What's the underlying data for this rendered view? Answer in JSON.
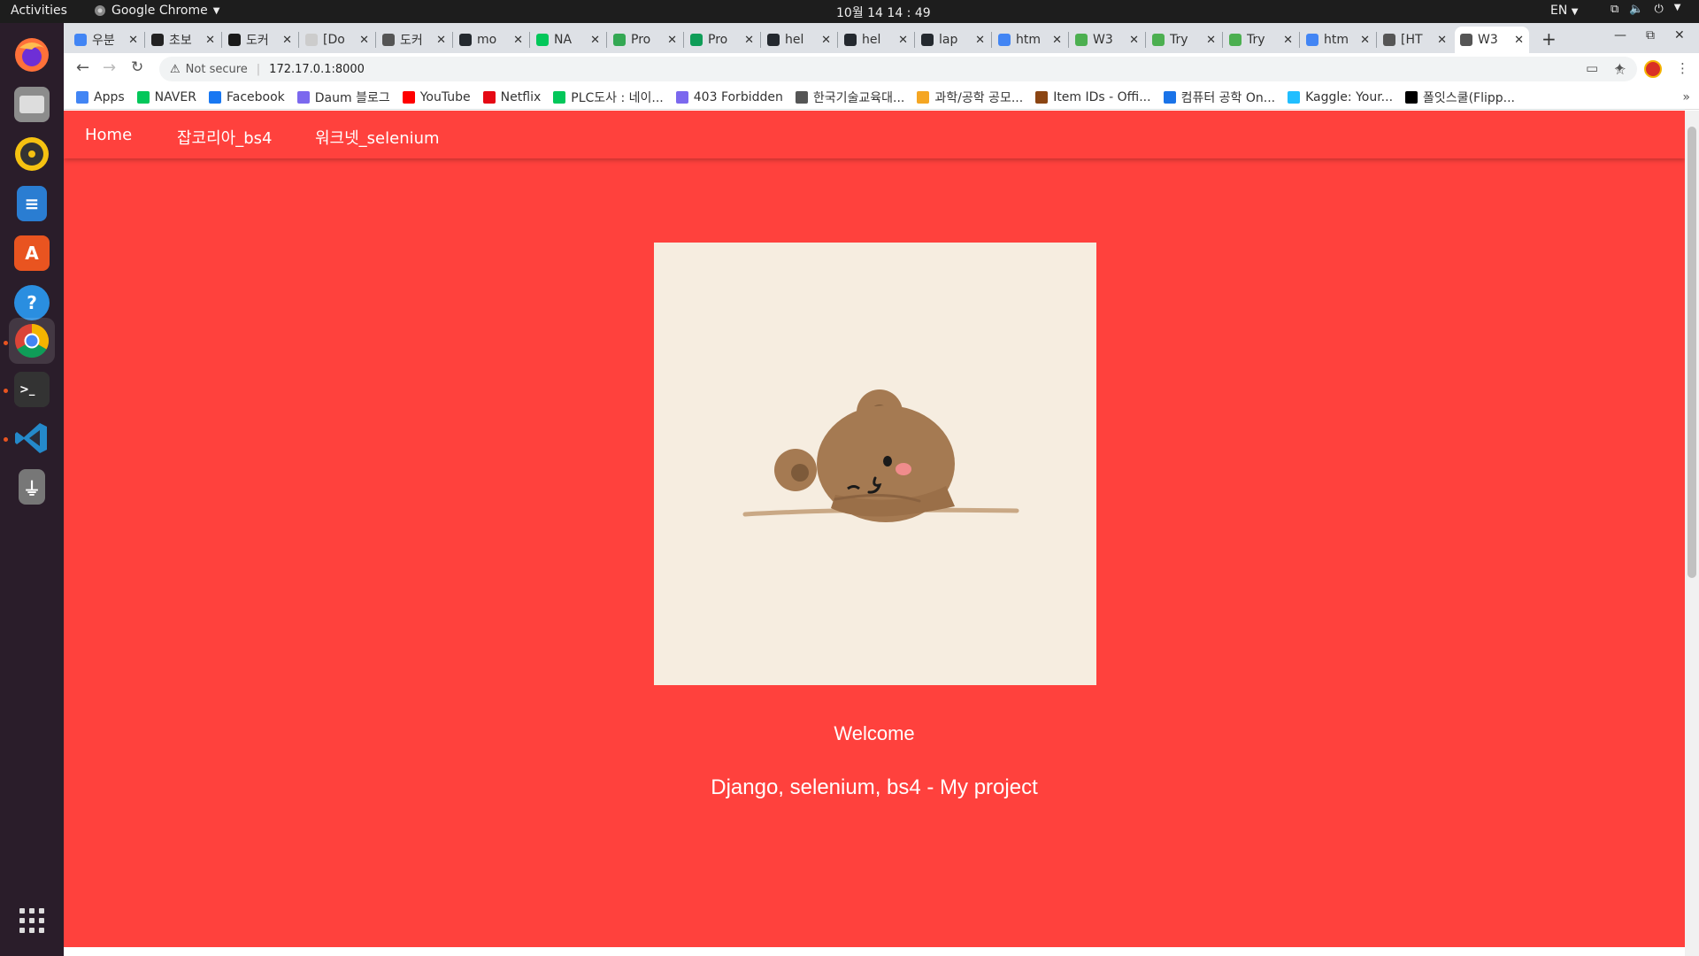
{
  "topbar": {
    "activities": "Activities",
    "app_name": "Google Chrome",
    "clock": "10월 14  14 : 49",
    "lang": "EN"
  },
  "dock": {
    "items": [
      "firefox-icon",
      "files-icon",
      "rhythmbox-icon",
      "libreoffice-writer-icon",
      "software-center-icon",
      "help-icon",
      "chrome-icon",
      "terminal-icon",
      "vscode-icon",
      "usb-drive-icon"
    ],
    "show_apps": "show-applications-icon"
  },
  "browser": {
    "tabs": [
      {
        "title": "우분",
        "color": "#4285f4",
        "glyph": "G"
      },
      {
        "title": "초보",
        "color": "#222222",
        "glyph": "</>"
      },
      {
        "title": "도커",
        "color": "#1a1a1a",
        "glyph": "44"
      },
      {
        "title": "[Do",
        "color": "#cccccc",
        "glyph": ""
      },
      {
        "title": "도커",
        "color": "#555555",
        "glyph": "⁘"
      },
      {
        "title": "mo",
        "color": "#24292f",
        "glyph": "◉"
      },
      {
        "title": "NA",
        "color": "#03c75a",
        "glyph": "N"
      },
      {
        "title": "Pro",
        "color": "#34a853",
        "glyph": "▲"
      },
      {
        "title": "Pro",
        "color": "#0f9d58",
        "glyph": "▦"
      },
      {
        "title": "hel",
        "color": "#24292f",
        "glyph": "◉"
      },
      {
        "title": "hel",
        "color": "#24292f",
        "glyph": "◉"
      },
      {
        "title": "lap",
        "color": "#24292f",
        "glyph": "◉"
      },
      {
        "title": "htm",
        "color": "#4285f4",
        "glyph": "G"
      },
      {
        "title": "W3",
        "color": "#4caf50",
        "glyph": "W3"
      },
      {
        "title": "Try",
        "color": "#4caf50",
        "glyph": "W3"
      },
      {
        "title": "Try",
        "color": "#4caf50",
        "glyph": "W3"
      },
      {
        "title": "htm",
        "color": "#4285f4",
        "glyph": "G"
      },
      {
        "title": "[HT",
        "color": "#555555",
        "glyph": "⁘"
      },
      {
        "title": "W3",
        "color": "#555555",
        "glyph": "◎"
      }
    ],
    "active_tab_index": 18,
    "not_secure": "Not secure",
    "url": "172.17.0.1:8000",
    "bookmarks": [
      {
        "label": "Apps",
        "color": "#4285f4"
      },
      {
        "label": "NAVER",
        "color": "#03c75a"
      },
      {
        "label": "Facebook",
        "color": "#1877f2"
      },
      {
        "label": "Daum 블로그",
        "color": "#7b68ee"
      },
      {
        "label": "YouTube",
        "color": "#ff0000"
      },
      {
        "label": "Netflix",
        "color": "#e50914"
      },
      {
        "label": "PLC도사 : 네이...",
        "color": "#03c75a"
      },
      {
        "label": "403 Forbidden",
        "color": "#7b68ee"
      },
      {
        "label": "한국기술교육대...",
        "color": "#555555"
      },
      {
        "label": "과학/공학 공모...",
        "color": "#f5a623"
      },
      {
        "label": "Item IDs - Offi...",
        "color": "#8b4513"
      },
      {
        "label": "컴퓨터 공학 On...",
        "color": "#1a73e8"
      },
      {
        "label": "Kaggle: Your...",
        "color": "#20beff"
      },
      {
        "label": "폴잇스쿨(Flipp...",
        "color": "#000000"
      }
    ]
  },
  "page": {
    "nav": {
      "home": "Home",
      "jobkorea": "잡코리아_bs4",
      "worknet": "워크넷_selenium"
    },
    "hero_image": "teddy-bear-illustration",
    "welcome": "Welcome",
    "subtitle": "Django, selenium, bs4 - My project",
    "colors": {
      "background": "#ff413d",
      "hero_bg": "#f6ede0",
      "bear": "#a57a52"
    }
  }
}
